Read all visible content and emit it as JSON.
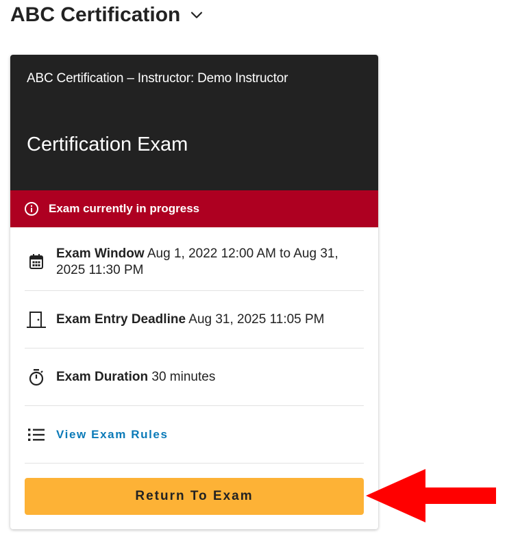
{
  "header": {
    "course_title": "ABC Certification",
    "chevron_icon": "chevron-down-icon"
  },
  "card": {
    "subtitle": "ABC Certification – Instructor: Demo Instructor",
    "title": "Certification Exam",
    "status": {
      "icon": "info-icon",
      "text": "Exam currently in progress",
      "color": "#ae0021"
    },
    "details": {
      "window": {
        "icon": "calendar-icon",
        "label": "Exam Window",
        "value": "Aug 1, 2022 12:00 AM to Aug 31, 2025 11:30 PM"
      },
      "entry_deadline": {
        "icon": "door-icon",
        "label": "Exam Entry Deadline",
        "value": "Aug 31, 2025 11:05 PM"
      },
      "duration": {
        "icon": "stopwatch-icon",
        "label": "Exam Duration",
        "value": "30 minutes"
      },
      "rules": {
        "icon": "list-icon",
        "link_label": "View Exam Rules",
        "link_color": "#0a7ab8"
      }
    },
    "return_button": {
      "label": "Return To Exam",
      "color": "#fdb236"
    }
  },
  "annotation": {
    "arrow_color": "#ff0000",
    "arrow_icon": "arrow-left-icon"
  }
}
